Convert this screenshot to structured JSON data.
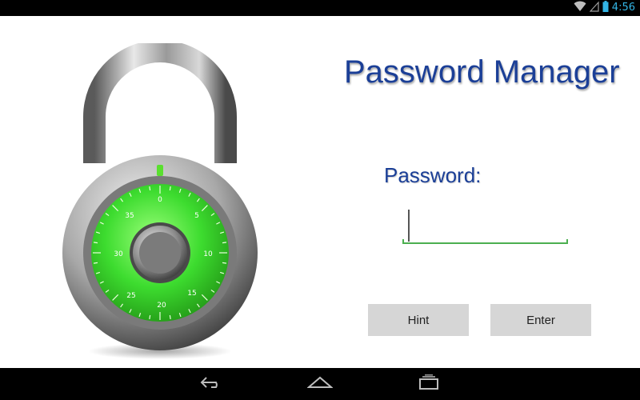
{
  "status_bar": {
    "time": "4:56",
    "icons": [
      "wifi-icon",
      "signal-icon",
      "battery-icon"
    ],
    "accent_color": "#33b5e5"
  },
  "app": {
    "title": "Password Manager",
    "title_color": "#1b3f97"
  },
  "lock_image": {
    "icon": "padlock-combination-icon",
    "dial_color": "#3ddc2f",
    "dial_numbers": [
      "0",
      "5",
      "10",
      "15",
      "20",
      "25",
      "30",
      "35"
    ]
  },
  "form": {
    "password_label": "Password:",
    "password_value": "",
    "underline_color": "#4caf50"
  },
  "buttons": {
    "hint": "Hint",
    "enter": "Enter"
  },
  "nav_bar": {
    "items": [
      "back-icon",
      "home-icon",
      "recent-apps-icon"
    ]
  }
}
